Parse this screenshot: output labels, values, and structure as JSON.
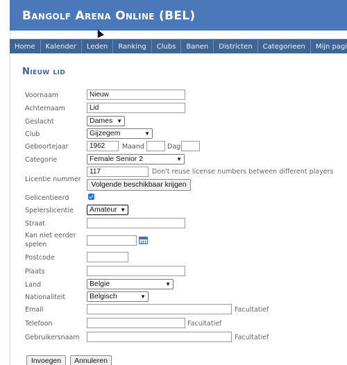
{
  "site": {
    "title": "Bangolf Arena Online (BEL)"
  },
  "nav": {
    "items": [
      {
        "label": "Home"
      },
      {
        "label": "Kalender"
      },
      {
        "label": "Leden"
      },
      {
        "label": "Ranking"
      },
      {
        "label": "Clubs"
      },
      {
        "label": "Banen"
      },
      {
        "label": "Districten"
      },
      {
        "label": "Categorieen"
      },
      {
        "label": "Mijn pagina"
      }
    ]
  },
  "page": {
    "heading": "Nieuw lid"
  },
  "form": {
    "voornaam": {
      "label": "Voornaam",
      "value": "Nieuw"
    },
    "achternaam": {
      "label": "Achternaam",
      "value": "Lid"
    },
    "geslacht": {
      "label": "Geslacht",
      "value": "Dames"
    },
    "club": {
      "label": "Club",
      "value": "Gijzegem"
    },
    "geboortejaar": {
      "label": "Geboortejaar",
      "value": "1962",
      "maand_label": "Maand",
      "maand_value": "",
      "dag_label": "Dag",
      "dag_value": ""
    },
    "categorie": {
      "label": "Categorie",
      "value": "Female Senior 2"
    },
    "licentie": {
      "label": "Licentie nummer",
      "value": "117",
      "hint": "Don't reuse license numbers between different players",
      "button": "Volgende beschikbaar krijgen"
    },
    "gelicentieerd": {
      "label": "Gelicentieerd",
      "checked": true
    },
    "spelerslicentie": {
      "label": "Spelerslicentie",
      "value": "Amateur"
    },
    "straat": {
      "label": "Straat",
      "value": ""
    },
    "kan_niet_eerder": {
      "label_line1": "Kan niet eerder",
      "label_line2": "spelen",
      "value": ""
    },
    "postcode": {
      "label": "Postcode",
      "value": ""
    },
    "plaats": {
      "label": "Plaats",
      "value": ""
    },
    "land": {
      "label": "Land",
      "value": "Belgie"
    },
    "nationaliteit": {
      "label": "Nationaliteit",
      "value": "Belgisch"
    },
    "email": {
      "label": "Email",
      "value": "",
      "hint": "Facultatief"
    },
    "telefoon": {
      "label": "Telefoon",
      "value": "",
      "hint": "Facultatief"
    },
    "gebruikersnaam": {
      "label": "Gebruikersnaam",
      "value": "",
      "hint": "Facultatief"
    }
  },
  "actions": {
    "insert_label": "Invoegen",
    "cancel_label": "Annuleren"
  }
}
